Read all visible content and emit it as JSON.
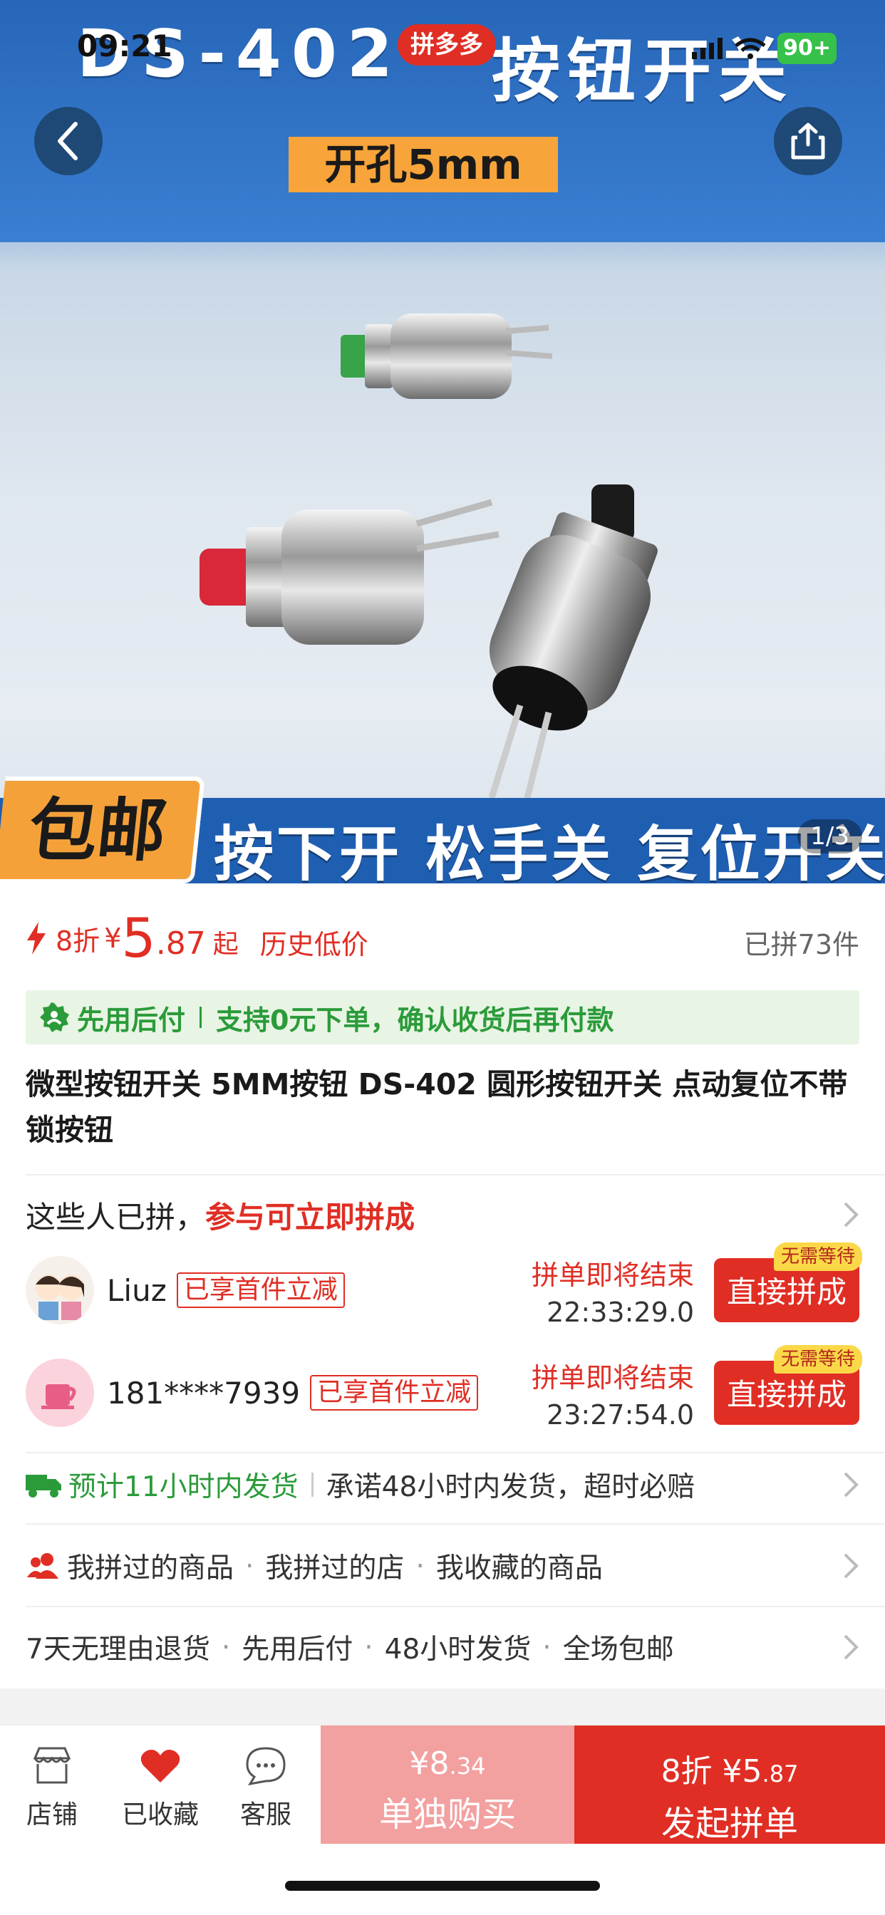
{
  "status": {
    "time": "09:21",
    "battery": "90+"
  },
  "hero": {
    "title_model": "DS-402",
    "title_name": "按钮开关",
    "badge": "拼多多",
    "hole_tag": "开孔5mm",
    "free_ship": "包邮",
    "banner": "按下开 松手关 复位开关",
    "page_indicator": "1/3"
  },
  "price": {
    "discount": "8折",
    "currency": "¥",
    "integer": "5",
    "decimal": ".87",
    "suffix": "起",
    "history_low": "历史低价",
    "sold": "已拼73件"
  },
  "pay_later": {
    "label": "先用后付",
    "desc": "支持0元下单，确认收货后再付款"
  },
  "product_title": "微型按钮开关 5MM按钮 DS-402 圆形按钮开关 点动复位不带锁按钮",
  "group_section": {
    "head_plain": "这些人已拼，",
    "head_bold": "参与可立即拼成",
    "rows": [
      {
        "name": "Liuz",
        "tag": "已享首件立减",
        "end_label": "拼单即将结束",
        "time": "22:33:29.0",
        "button": "直接拼成",
        "no_wait": "无需等待"
      },
      {
        "name": "181****7939",
        "tag": "已享首件立减",
        "end_label": "拼单即将结束",
        "time": "23:27:54.0",
        "button": "直接拼成",
        "no_wait": "无需等待"
      }
    ]
  },
  "shipping": {
    "eta": "预计11小时内发货",
    "promise": "承诺48小时内发货，超时必赔"
  },
  "history_links": [
    "我拼过的商品",
    "我拼过的店",
    "我收藏的商品"
  ],
  "services": [
    "7天无理由退货",
    "先用后付",
    "48小时发货",
    "全场包邮"
  ],
  "bottom_bar": {
    "store": "店铺",
    "favorited": "已收藏",
    "service": "客服",
    "single_price": "¥8",
    "single_decimal": ".34",
    "single_label": "单独购买",
    "group_price": "8折 ¥5",
    "group_decimal": ".87",
    "group_label": "发起拼单"
  },
  "colors": {
    "brand_red": "#e02e24",
    "green": "#2b9b3a",
    "light_red": "#f3a0a0"
  }
}
